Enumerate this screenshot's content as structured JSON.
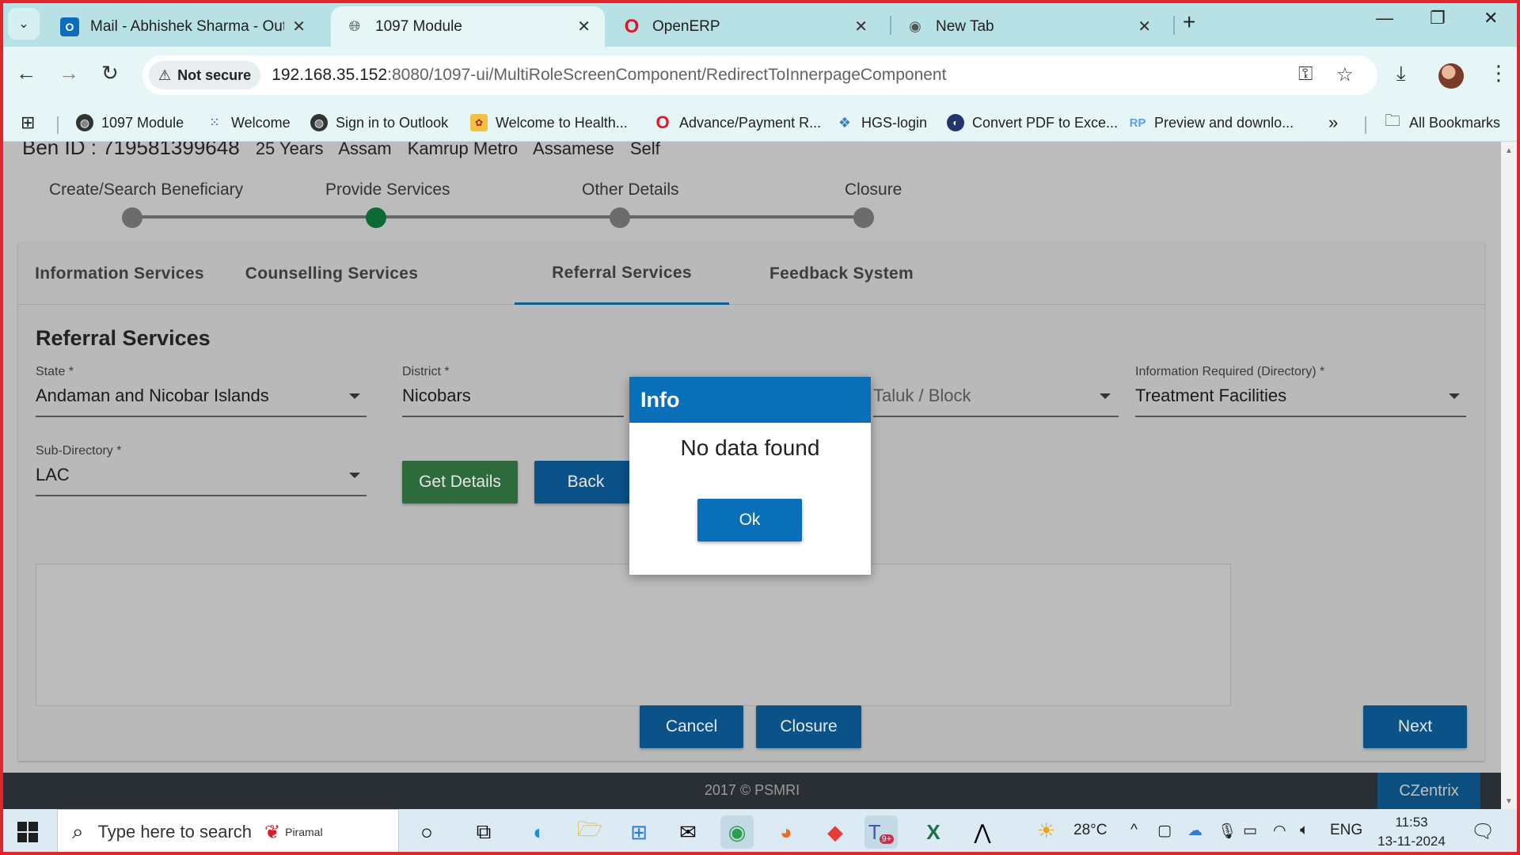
{
  "browser": {
    "tabs": [
      {
        "label": "Mail - Abhishek Sharma - Outlo",
        "icon": "outlook-icon",
        "active": false
      },
      {
        "label": "1097 Module",
        "icon": "globe-icon",
        "active": true
      },
      {
        "label": "OpenERP",
        "icon": "opera-icon",
        "active": false
      },
      {
        "label": "New Tab",
        "icon": "chrome-icon",
        "active": false
      }
    ],
    "security_label": "Not secure",
    "url_host": "192.168.35.152",
    "url_rest": ":8080/1097-ui/MultiRoleScreenComponent/RedirectToInnerpageComponent",
    "bookmarks": [
      {
        "label": "1097 Module",
        "icon": "globe-icon"
      },
      {
        "label": "Welcome",
        "icon": "dots-grid-icon"
      },
      {
        "label": "Sign in to Outlook",
        "icon": "globe-icon"
      },
      {
        "label": "Welcome to Health...",
        "icon": "health-icon"
      },
      {
        "label": "Advance/Payment R...",
        "icon": "opera-icon"
      },
      {
        "label": "HGS-login",
        "icon": "hgs-icon"
      },
      {
        "label": "Convert PDF to Exce...",
        "icon": "pdf-icon"
      },
      {
        "label": "Preview and downlo...",
        "icon": "rp-icon"
      }
    ],
    "all_bookmarks": "All Bookmarks"
  },
  "beneficiary": {
    "id": "Ben ID : 719581399648",
    "age": "25 Years",
    "state": "Assam",
    "district": "Kamrup Metro",
    "language": "Assamese",
    "relation": "Self"
  },
  "steps": [
    {
      "label": "Create/Search Beneficiary",
      "active": false
    },
    {
      "label": "Provide Services",
      "active": true
    },
    {
      "label": "Other Details",
      "active": false
    },
    {
      "label": "Closure",
      "active": false
    }
  ],
  "service_tabs": [
    {
      "label": "Information Services",
      "active": false
    },
    {
      "label": "Counselling Services",
      "active": false
    },
    {
      "label": "Referral Services",
      "active": true
    },
    {
      "label": "Feedback System",
      "active": false
    }
  ],
  "form": {
    "title": "Referral Services",
    "state_label": "State *",
    "state_value": "Andaman and Nicobar Islands",
    "district_label": "District *",
    "district_value": "Nicobars",
    "taluk_placeholder": "Taluk / Block",
    "info_required_label": "Information Required (Directory) *",
    "info_required_value": "Treatment Facilities",
    "subdirectory_label": "Sub-Directory *",
    "subdirectory_value": "LAC",
    "get_details": "Get Details",
    "back": "Back",
    "cancel": "Cancel",
    "closure": "Closure",
    "next": "Next"
  },
  "footer": {
    "copyright": "2017 © PSMRI",
    "brand": "CZentrix"
  },
  "modal": {
    "title": "Info",
    "message": "No data found",
    "ok": "Ok"
  },
  "taskbar": {
    "search_placeholder": "Type here to search",
    "piramal_label": "Piramal",
    "temperature": "28°C",
    "language": "ENG",
    "time": "11:53",
    "date": "13-11-2024",
    "teams_badge": "9+"
  },
  "colors": {
    "accent_blue": "#0a6fb9",
    "nav_blue": "#0a5288",
    "get_details_green": "#2d6a3c",
    "active_step": "#0c6b34",
    "frame_red": "#e1252f"
  }
}
